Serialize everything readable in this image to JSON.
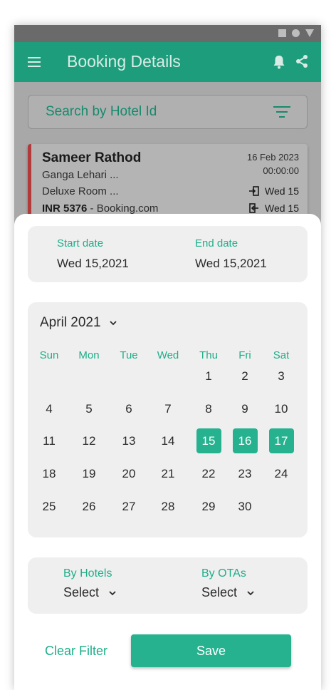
{
  "app_title": "Booking Details",
  "icons": {
    "menu": "hamburger-icon",
    "notifications": "bell-icon",
    "share": "share-icon",
    "filter": "filter-icon",
    "checkin": "check-in-icon",
    "checkout": "check-out-icon",
    "dropdown": "chevron-down-icon"
  },
  "colors": {
    "primary": "#1e9d7d",
    "accent": "#26b28f",
    "card_stripe": "#b13a3a"
  },
  "search": {
    "placeholder": "Search by Hotel Id"
  },
  "booking": {
    "guest_name": "Sameer Rathod",
    "hotel": "Ganga Lehari ...",
    "room": "Deluxe Room ...",
    "price": "INR 5376",
    "source": " - Booking.com",
    "date": "16 Feb 2023",
    "time": "00:00:00",
    "checkin": "Wed 15",
    "checkout": "Wed 15"
  },
  "date_range": {
    "start_label": "Start date",
    "start_value": "Wed 15,2021",
    "end_label": "End date",
    "end_value": "Wed 15,2021"
  },
  "calendar": {
    "month": "April 2021",
    "weekdays": [
      "Sun",
      "Mon",
      "Tue",
      "Wed",
      "Thu",
      "Fri",
      "Sat"
    ],
    "weeks": [
      [
        "",
        "",
        "",
        "",
        "1",
        "2",
        "3"
      ],
      [
        "4",
        "5",
        "6",
        "7",
        "8",
        "9",
        "10"
      ],
      [
        "11",
        "12",
        "13",
        "14",
        "15",
        "16",
        "17"
      ],
      [
        "18",
        "19",
        "20",
        "21",
        "22",
        "23",
        "24"
      ],
      [
        "25",
        "26",
        "27",
        "28",
        "29",
        "30",
        ""
      ]
    ],
    "selected": [
      "15",
      "16",
      "17"
    ]
  },
  "filters": {
    "hotels_label": "By Hotels",
    "hotels_value": "Select",
    "otas_label": "By  OTAs",
    "otas_value": "Select"
  },
  "actions": {
    "clear_label": "Clear Filter",
    "save_label": "Save"
  }
}
